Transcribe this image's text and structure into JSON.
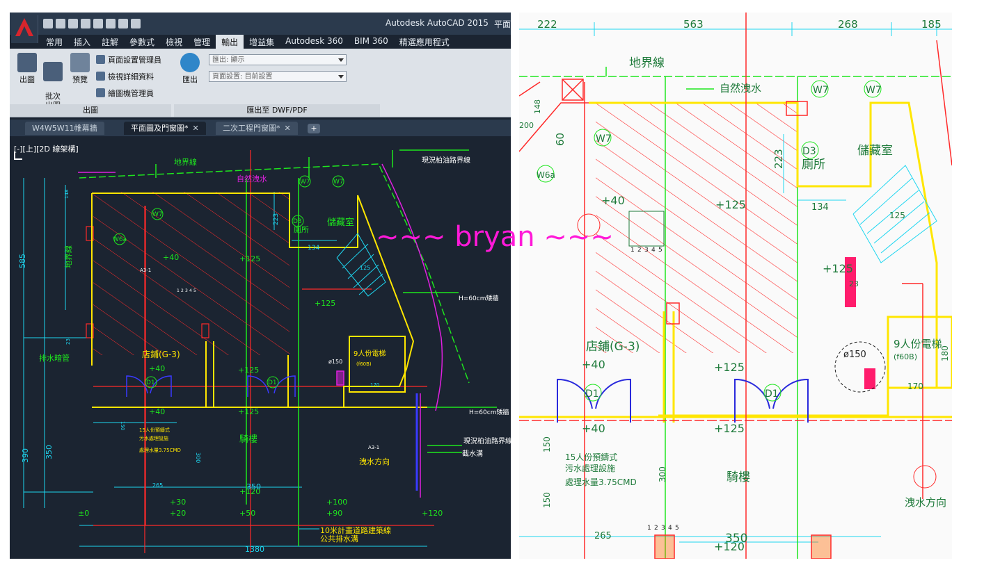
{
  "app": {
    "title": "Autodesk AutoCAD 2015",
    "title_suffix": "平面",
    "ribbon_tabs": [
      "常用",
      "插入",
      "註解",
      "參數式",
      "檢視",
      "管理",
      "輸出",
      "增益集",
      "Autodesk 360",
      "BIM 360",
      "精選應用程式"
    ],
    "active_tab": "輸出"
  },
  "ribbon": {
    "plot_label": "出圖",
    "batch_plot_label": "批次\n出圖",
    "preview_label": "預覽",
    "page_setup_manager": "頁面設置管理員",
    "view_details": "檢視詳細資料",
    "plotter_manager": "繪圖機管理員",
    "plot_panel_title": "出圖",
    "export_label": "匯出",
    "export_combo_value": "匯出: 顯示",
    "page_setup_combo_value": "頁面設置: 目前設置",
    "export_panel_title": "匯出至 DWF/PDF"
  },
  "document_tabs": [
    {
      "label": "W4W5W11帷幕牆",
      "active": false
    },
    {
      "label": "平面圖及門窗圖*",
      "active": true
    },
    {
      "label": "二次工程門窗圖*",
      "active": false
    }
  ],
  "viewport_label": "[-][上][2D 線架構]",
  "drawing": {
    "property_line": "地界線",
    "natural_drain": "自然洩水",
    "existing_road_line": "現況柏油路界線",
    "wall_note_1": "H=60cm矮牆",
    "wall_note_2": "H=60cm矮牆",
    "existing_road_line_2": "現況柏油路界線",
    "intercept_ditch": "截水溝",
    "drain_pipe": "排水暗管",
    "toilet": "廁所",
    "storage": "儲藏室",
    "shop": "店鋪(G-3)",
    "arcade": "騎樓",
    "drain_direction": "洩水方向",
    "elevator": "9人份電梯",
    "elevator_code": "(f60B)",
    "road_line": "10米計畫道路建築線",
    "public_ditch": "公共排水溝",
    "sewage_1": "15人份預鑄式",
    "sewage_2": "污水處理設施",
    "sewage_3": "處理水量3.75CMD",
    "level_40": "+40",
    "level_125": "+125",
    "level_120": "+120",
    "level_100": "+100",
    "level_90": "+90",
    "level_50": "+50",
    "level_30": "+30",
    "level_20": "+20",
    "level_0": "±0",
    "dims": {
      "d585": "585",
      "d390": "390",
      "d350": "350",
      "d1380": "1380",
      "d223": "223",
      "d134": "134",
      "d125": "125",
      "d265": "265",
      "d300": "300",
      "d150": "150",
      "d170": "170",
      "d180": "180",
      "d222": "222",
      "d563": "563",
      "d268": "268",
      "d185": "185",
      "d60": "60",
      "d200": "200",
      "d23": "23",
      "d148": "148"
    },
    "tags": {
      "w7": "W7",
      "w6a": "W6a",
      "d1": "D1",
      "d3": "D3",
      "a31": "A3-1",
      "dia150": "ø150"
    },
    "stair_nums": [
      "1",
      "2",
      "3",
      "4",
      "5"
    ]
  },
  "watermark": "~~~ bryan ~~~",
  "colors": {
    "acad_bg": "#1b2431",
    "ribbon_bg": "#dde2e8",
    "red": "#ff2a2a",
    "yellow": "#ffe600",
    "green": "#1ee61e",
    "cyan": "#1ed6f0",
    "magenta": "#e020e0",
    "blue": "#3a3aff",
    "watermark": "#ff19d8"
  }
}
